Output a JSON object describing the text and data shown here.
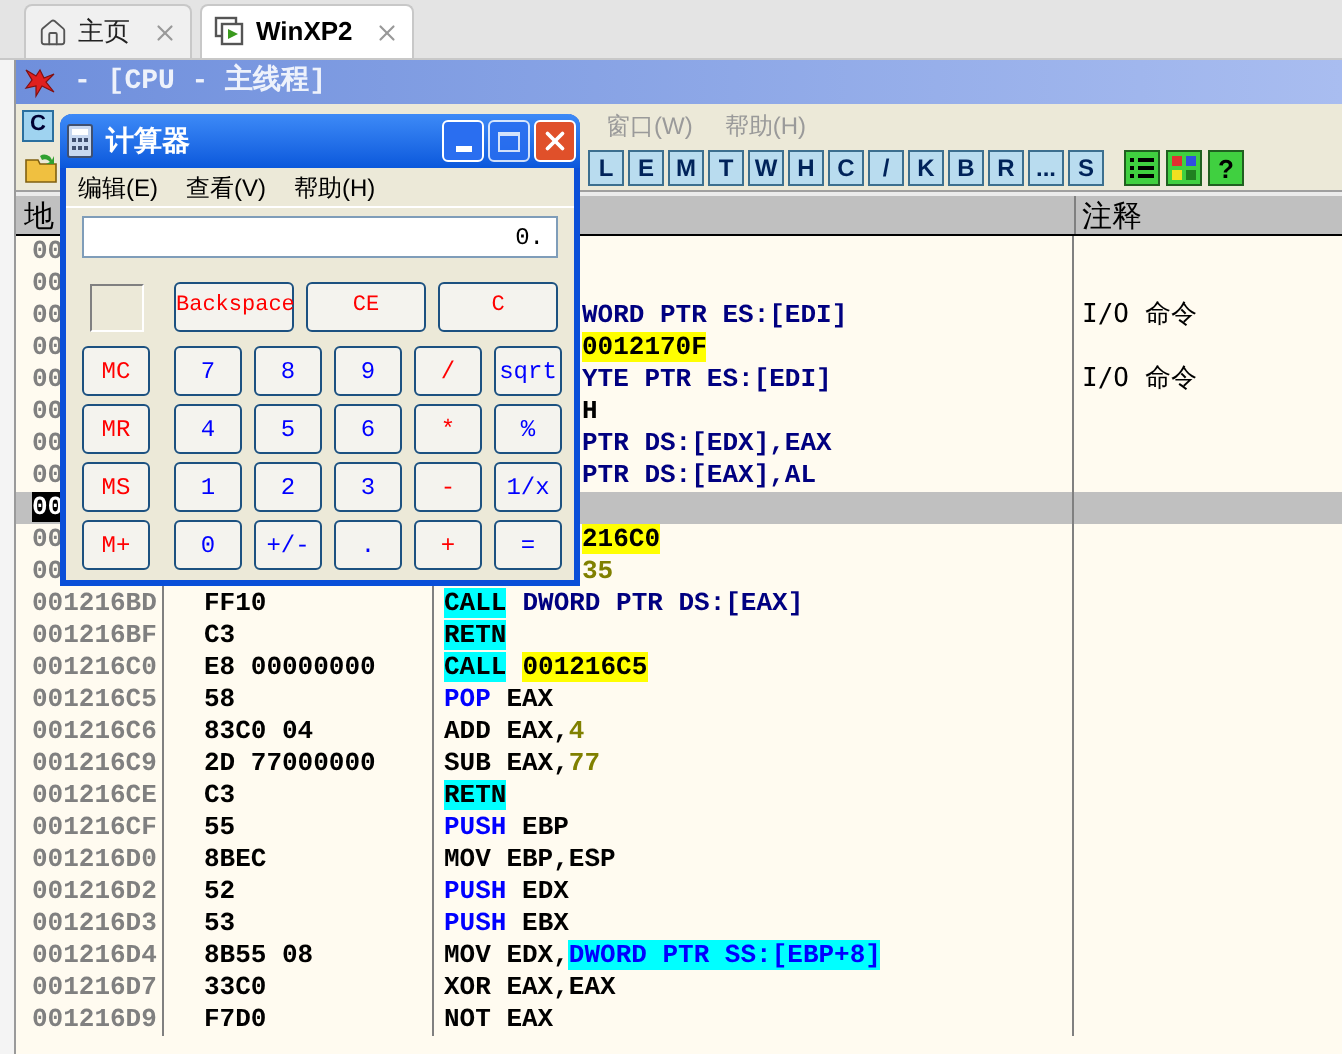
{
  "browser_tabs": [
    {
      "label": "主页",
      "selected": false
    },
    {
      "label": "WinXP2",
      "selected": true
    }
  ],
  "window": {
    "title": "- [CPU - 主线程]"
  },
  "menu": {
    "badge": "C",
    "items": [
      "窗口(W)",
      "帮助(H)"
    ]
  },
  "toolbar": {
    "letter_buttons": [
      "L",
      "E",
      "M",
      "T",
      "W",
      "H",
      "C",
      "/",
      "K",
      "B",
      "R",
      "...",
      "S"
    ],
    "help_button": "?"
  },
  "columns": [
    "地",
    "注释"
  ],
  "rows": [
    {
      "kind": "covered",
      "address": "00",
      "selected": false,
      "disasm": [],
      "comment": ""
    },
    {
      "kind": "covered",
      "address": "00",
      "selected": false,
      "disasm": [],
      "comment": ""
    },
    {
      "kind": "covered",
      "address": "00",
      "selected": false,
      "disasm": [
        {
          "text": "WORD PTR ES:[EDI]",
          "kind": "mem"
        }
      ],
      "comment": "I/O 命令"
    },
    {
      "kind": "covered",
      "address": "00",
      "selected": false,
      "disasm": [
        {
          "text": "0012170F",
          "kind": "target"
        }
      ],
      "comment": ""
    },
    {
      "kind": "covered",
      "address": "00",
      "selected": false,
      "disasm": [
        {
          "text": "YTE PTR ES:[EDI]",
          "kind": "mem"
        }
      ],
      "comment": "I/O 命令"
    },
    {
      "kind": "covered",
      "address": "00",
      "selected": false,
      "disasm": [
        {
          "text": "H",
          "kind": "plain"
        }
      ],
      "comment": ""
    },
    {
      "kind": "covered",
      "address": "00",
      "selected": false,
      "disasm": [
        {
          "text": "PTR DS:[EDX],EAX",
          "kind": "mem"
        }
      ],
      "comment": ""
    },
    {
      "kind": "covered",
      "address": "00",
      "selected": false,
      "disasm": [
        {
          "text": "PTR DS:[EAX],AL",
          "kind": "mem"
        }
      ],
      "comment": ""
    },
    {
      "kind": "covered",
      "address": "00",
      "selected": true,
      "disasm": [],
      "comment": ""
    },
    {
      "kind": "covered",
      "address": "00",
      "selected": false,
      "disasm": [
        {
          "text": "216C0",
          "kind": "target"
        }
      ],
      "comment": ""
    },
    {
      "kind": "covered",
      "address": "00",
      "selected": false,
      "disasm": [
        {
          "text": "35",
          "kind": "const"
        }
      ],
      "comment": ""
    },
    {
      "kind": "full",
      "address": "001216BD",
      "hex": "FF10",
      "selected": false,
      "disasm": [
        {
          "text": "CALL",
          "kind": "jump"
        },
        {
          "text": "DWORD PTR DS:[EAX]",
          "kind": "mem"
        }
      ],
      "comment": ""
    },
    {
      "kind": "full",
      "address": "001216BF",
      "hex": "C3",
      "selected": false,
      "disasm": [
        {
          "text": "RETN",
          "kind": "jump"
        }
      ],
      "comment": ""
    },
    {
      "kind": "full",
      "address": "001216C0",
      "hex": "E8 00000000",
      "selected": false,
      "disasm": [
        {
          "text": "CALL",
          "kind": "jump"
        },
        {
          "text": "001216C5",
          "kind": "target"
        }
      ],
      "comment": ""
    },
    {
      "kind": "full",
      "address": "001216C5",
      "hex": "58",
      "selected": false,
      "disasm": [
        {
          "text": "POP",
          "kind": "stack"
        },
        {
          "text": " EAX",
          "kind": "plain"
        }
      ],
      "comment": ""
    },
    {
      "kind": "full",
      "address": "001216C6",
      "hex": "83C0 04",
      "selected": false,
      "disasm": [
        {
          "text": "ADD EAX,",
          "kind": "plain"
        },
        {
          "text": "4",
          "kind": "const"
        }
      ],
      "comment": ""
    },
    {
      "kind": "full",
      "address": "001216C9",
      "hex": "2D 77000000",
      "selected": false,
      "disasm": [
        {
          "text": "SUB EAX,",
          "kind": "plain"
        },
        {
          "text": "77",
          "kind": "const"
        }
      ],
      "comment": ""
    },
    {
      "kind": "full",
      "address": "001216CE",
      "hex": "C3",
      "selected": false,
      "disasm": [
        {
          "text": "RETN",
          "kind": "jump"
        }
      ],
      "comment": ""
    },
    {
      "kind": "full",
      "address": "001216CF",
      "hex": "55",
      "selected": false,
      "disasm": [
        {
          "text": "PUSH",
          "kind": "stack"
        },
        {
          "text": " EBP",
          "kind": "plain"
        }
      ],
      "comment": ""
    },
    {
      "kind": "full",
      "address": "001216D0",
      "hex": "8BEC",
      "selected": false,
      "disasm": [
        {
          "text": "MOV EBP,ESP",
          "kind": "plain"
        }
      ],
      "comment": ""
    },
    {
      "kind": "full",
      "address": "001216D2",
      "hex": "52",
      "selected": false,
      "disasm": [
        {
          "text": "PUSH",
          "kind": "stack"
        },
        {
          "text": " EDX",
          "kind": "plain"
        }
      ],
      "comment": ""
    },
    {
      "kind": "full",
      "address": "001216D3",
      "hex": "53",
      "selected": false,
      "disasm": [
        {
          "text": "PUSH",
          "kind": "stack"
        },
        {
          "text": " EBX",
          "kind": "plain"
        }
      ],
      "comment": ""
    },
    {
      "kind": "full",
      "address": "001216D4",
      "hex": "8B55 08",
      "selected": false,
      "disasm": [
        {
          "text": "MOV EDX,",
          "kind": "plain"
        },
        {
          "text": "DWORD PTR SS:[EBP+8]",
          "kind": "memhl"
        }
      ],
      "comment": ""
    },
    {
      "kind": "full",
      "address": "001216D7",
      "hex": "33C0",
      "selected": false,
      "disasm": [
        {
          "text": "XOR EAX,EAX",
          "kind": "plain"
        }
      ],
      "comment": ""
    },
    {
      "kind": "full",
      "address": "001216D9",
      "hex": "F7D0",
      "selected": false,
      "disasm": [
        {
          "text": "NOT EAX",
          "kind": "plain"
        }
      ],
      "comment": ""
    }
  ],
  "calculator": {
    "title": "计算器",
    "menu": [
      "编辑(E)",
      "查看(V)",
      "帮助(H)"
    ],
    "display": "0.",
    "top_keys": [
      {
        "label": "Backspace",
        "color": "#ff0000"
      },
      {
        "label": "CE",
        "color": "#ff0000"
      },
      {
        "label": "C",
        "color": "#ff0000"
      }
    ],
    "key_rows": [
      [
        {
          "label": "MC",
          "color": "#ff0000"
        },
        {
          "label": "7",
          "color": "#0000ff"
        },
        {
          "label": "8",
          "color": "#0000ff"
        },
        {
          "label": "9",
          "color": "#0000ff"
        },
        {
          "label": "/",
          "color": "#ff0000"
        },
        {
          "label": "sqrt",
          "color": "#0000ff"
        }
      ],
      [
        {
          "label": "MR",
          "color": "#ff0000"
        },
        {
          "label": "4",
          "color": "#0000ff"
        },
        {
          "label": "5",
          "color": "#0000ff"
        },
        {
          "label": "6",
          "color": "#0000ff"
        },
        {
          "label": "*",
          "color": "#ff0000"
        },
        {
          "label": "%",
          "color": "#0000ff"
        }
      ],
      [
        {
          "label": "MS",
          "color": "#ff0000"
        },
        {
          "label": "1",
          "color": "#0000ff"
        },
        {
          "label": "2",
          "color": "#0000ff"
        },
        {
          "label": "3",
          "color": "#0000ff"
        },
        {
          "label": "-",
          "color": "#ff0000"
        },
        {
          "label": "1/x",
          "color": "#0000ff"
        }
      ],
      [
        {
          "label": "M+",
          "color": "#ff0000"
        },
        {
          "label": "0",
          "color": "#0000ff"
        },
        {
          "label": "+/-",
          "color": "#0000ff"
        },
        {
          "label": ".",
          "color": "#0000ff"
        },
        {
          "label": "+",
          "color": "#ff0000"
        },
        {
          "label": "=",
          "color": "#0000ff"
        }
      ]
    ]
  }
}
